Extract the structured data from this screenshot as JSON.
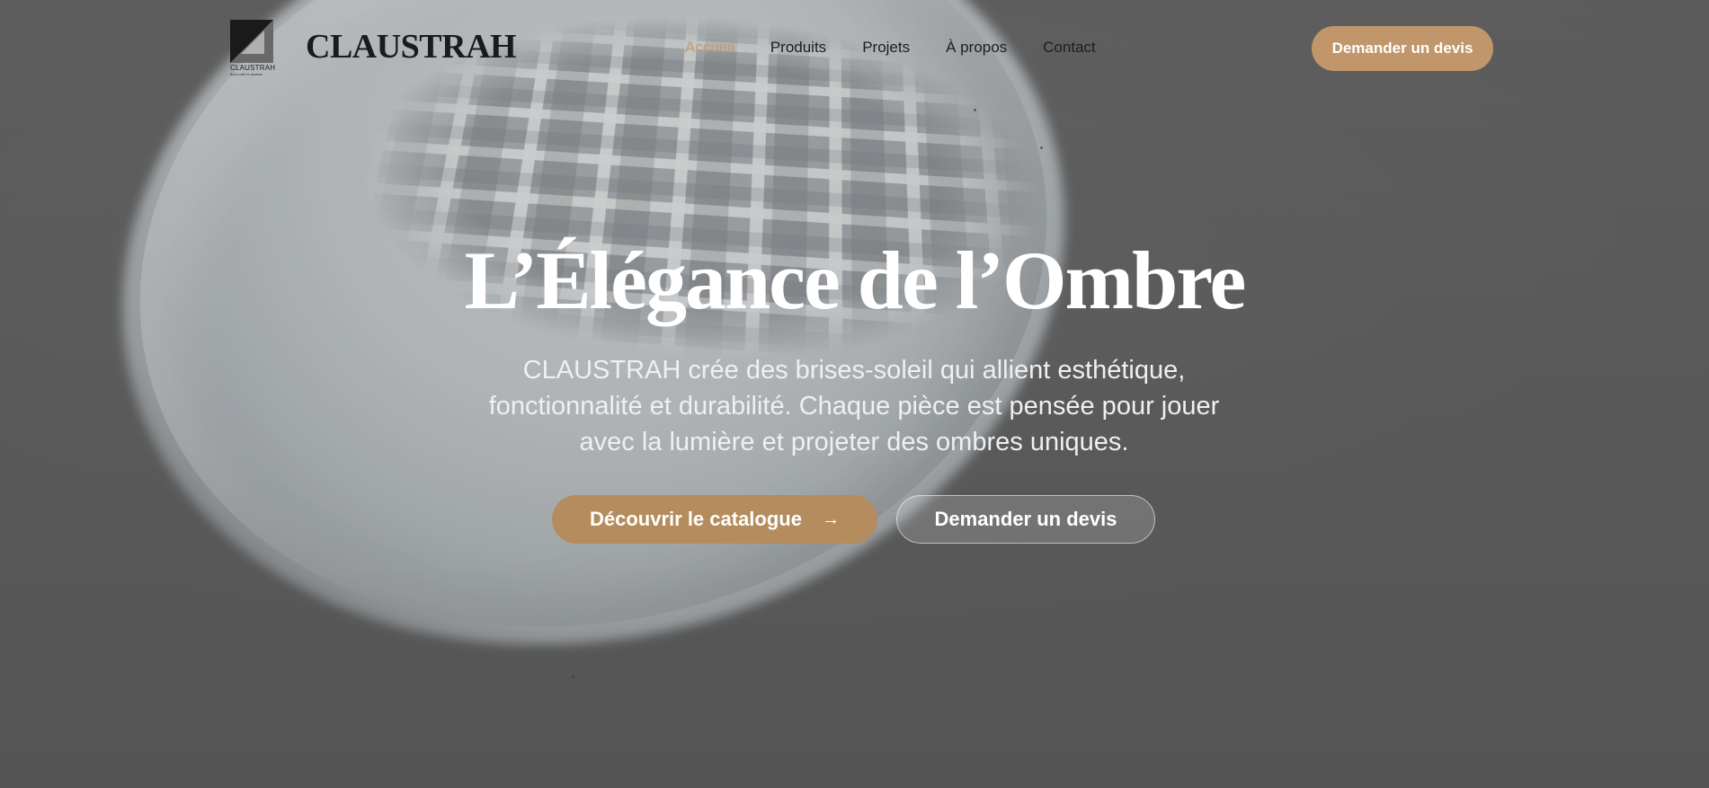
{
  "header": {
    "logo_small_text": "CLAUSTRAH",
    "logo_tagline": "Brise-soleil et claustras",
    "brand": "CLAUSTRAH",
    "nav": [
      {
        "label": "Accueil",
        "active": true
      },
      {
        "label": "Produits",
        "active": false
      },
      {
        "label": "Projets",
        "active": false
      },
      {
        "label": "À propos",
        "active": false
      },
      {
        "label": "Contact",
        "active": false
      }
    ],
    "cta_label": "Demander un devis"
  },
  "hero": {
    "title": "L’Élégance de l’Ombre",
    "subtitle": "CLAUSTRAH crée des brises-soleil qui allient esthétique, fonctionnalité et durabilité. Chaque pièce est pensée pour jouer avec la lumière et projeter des ombres uniques.",
    "primary_button": "Découvrir le catalogue",
    "secondary_button": "Demander un devis"
  },
  "colors": {
    "accent": "#c0966a",
    "accent_dark": "#b58c5d",
    "active_nav": "#c39a6b",
    "background": "#5f5f5f",
    "text_dark": "#1b1b1b",
    "text_light": "#ffffff"
  },
  "icons": {
    "primary_button_icon": "arrow-right-icon",
    "logo_icon": "claustrah-logo-icon"
  }
}
